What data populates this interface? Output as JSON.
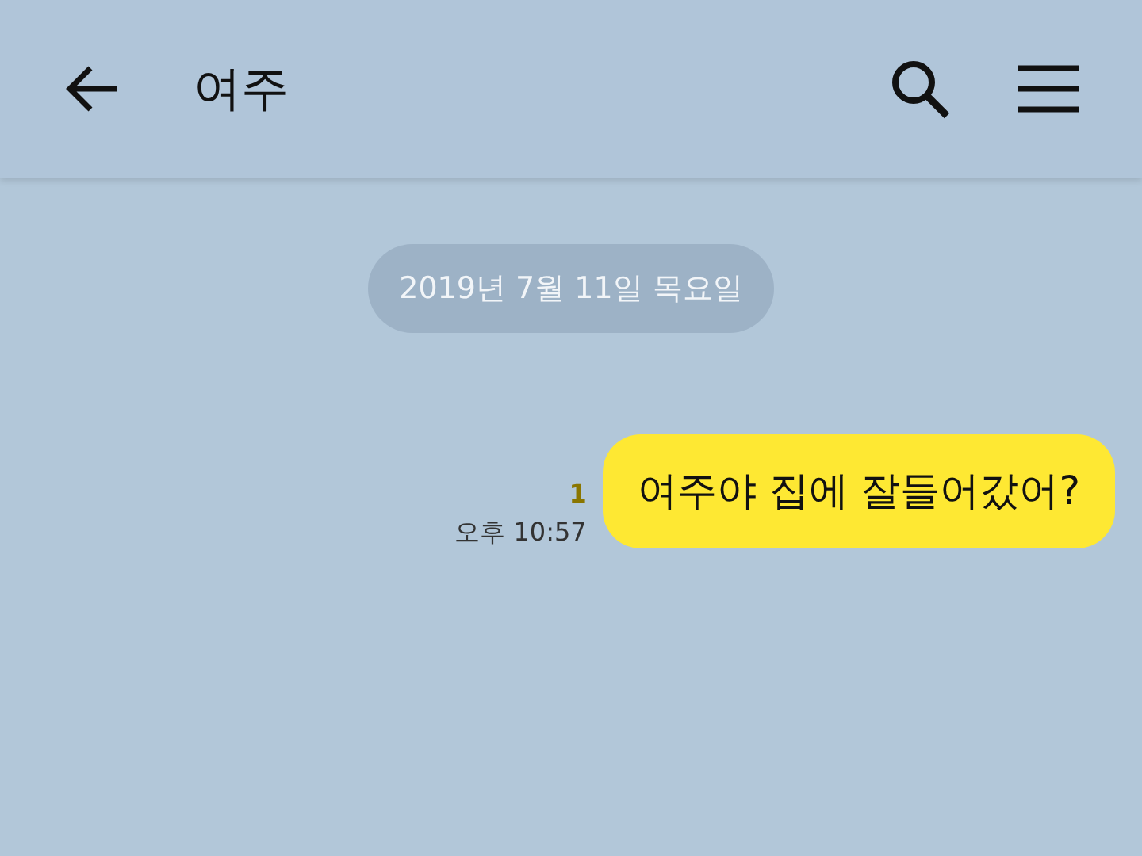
{
  "header": {
    "title": "여주"
  },
  "date_divider": "2019년 7월 11일 목요일",
  "messages": [
    {
      "kind": "sent",
      "text": "여주야 집에 잘들어갔어?",
      "unread": "1",
      "time": "오후 10:57"
    }
  ]
}
